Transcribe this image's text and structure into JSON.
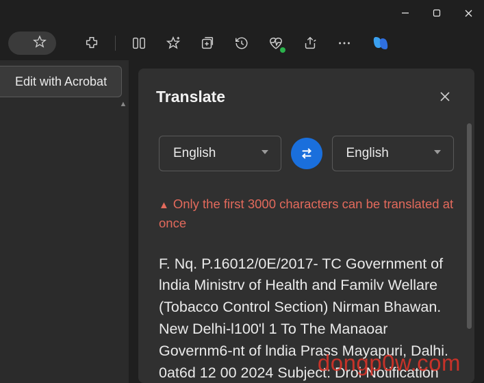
{
  "window": {
    "controls": {
      "min": "minimize",
      "max": "maximize",
      "close": "close"
    }
  },
  "toolbar": {
    "favorite": "favorite-star",
    "extensions": "extensions",
    "split": "split-screen",
    "favorites": "favorites-star-plus",
    "collections": "collections",
    "history": "history",
    "health": "browser-health",
    "share": "share",
    "more": "more",
    "copilot": "copilot"
  },
  "left": {
    "acrobat_label": "Edit with Acrobat"
  },
  "translate": {
    "title": "Translate",
    "source_lang": "English",
    "target_lang": "English",
    "warning": "Only the first 3000 characters can be translated at once",
    "output_text": "F. Nq. P.16012/0E/2017- TC Government of lndia Ministrv of Health and Familv Wellare (Tobacco Control Section) Nirman Bhawan. New Delhi-l100'l 1 To The Manaoar Governm6-nt of lndia Prass Mayapuri, Dalhi. 0at6d 12 00 2024 Subject: Droi Notification"
  },
  "watermark": "dongp0w.com"
}
